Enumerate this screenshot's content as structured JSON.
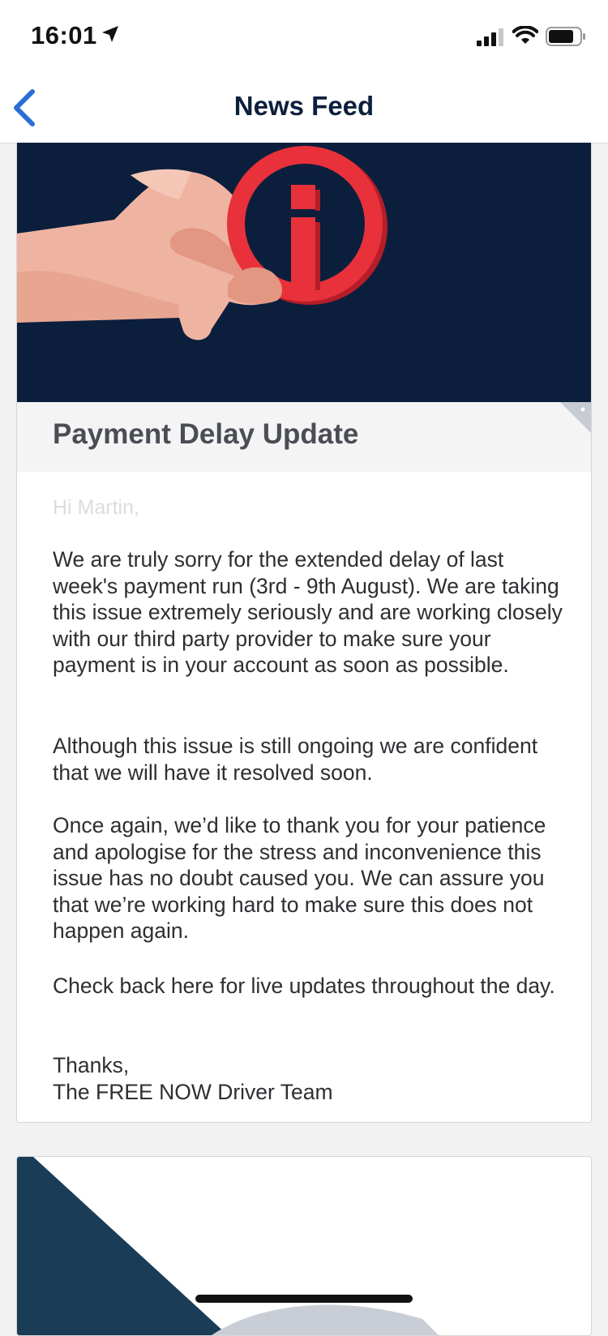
{
  "status_bar": {
    "time": "16:01"
  },
  "nav": {
    "title": "News Feed"
  },
  "post": {
    "title": "Payment Delay Update",
    "greeting": "Hi Martin,",
    "paragraphs": [
      "We are truly sorry for the extended delay of last week's payment run (3rd - 9th August). We are taking this issue extremely seriously and are working closely with our third party provider to make sure your payment is in your account as soon as possible.",
      "Although this issue is still ongoing we are confident that we will have it resolved soon.",
      "Once again, we’d like to thank you for your patience and apologise for the stress and inconvenience this issue has no doubt caused you. We can assure you that we’re working hard to make sure this does not happen again.",
      "Check back here for live updates throughout the day."
    ],
    "signoff_line1": "Thanks,",
    "signoff_line2": "The FREE NOW Driver Team"
  },
  "colors": {
    "hero_bg": "#0b1f3d",
    "accent_red": "#e8313a",
    "back_blue": "#2a6fd6"
  },
  "icons": [
    "location-arrow-icon",
    "signal-icon",
    "wifi-icon",
    "battery-icon",
    "back-chevron-icon",
    "info-icon"
  ]
}
